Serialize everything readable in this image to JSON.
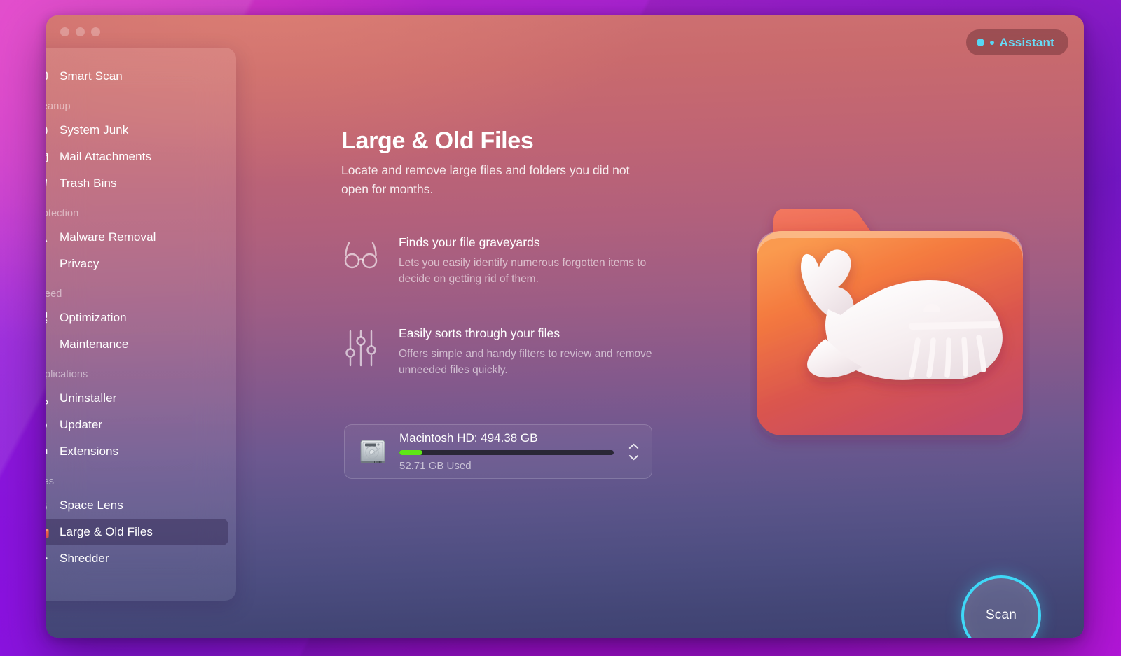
{
  "window": {
    "traffic_lights": [
      "close",
      "minimize",
      "maximize"
    ]
  },
  "assistant": {
    "label": "Assistant",
    "accent_color": "#67dcf8"
  },
  "sidebar": {
    "items": [
      {
        "label": "Smart Scan",
        "icon": "smart-scan-icon",
        "type": "item",
        "selected": false
      },
      {
        "label": "Cleanup",
        "type": "group"
      },
      {
        "label": "System Junk",
        "icon": "system-junk-icon",
        "type": "item",
        "selected": false
      },
      {
        "label": "Mail Attachments",
        "icon": "mail-attachments-icon",
        "type": "item",
        "selected": false
      },
      {
        "label": "Trash Bins",
        "icon": "trash-bins-icon",
        "type": "item",
        "selected": false
      },
      {
        "label": "Protection",
        "type": "group"
      },
      {
        "label": "Malware Removal",
        "icon": "malware-removal-icon",
        "type": "item",
        "selected": false
      },
      {
        "label": "Privacy",
        "icon": "privacy-hand-icon",
        "type": "item",
        "selected": false
      },
      {
        "label": "Speed",
        "type": "group"
      },
      {
        "label": "Optimization",
        "icon": "optimization-sliders-icon",
        "type": "item",
        "selected": false
      },
      {
        "label": "Maintenance",
        "icon": "maintenance-wrench-icon",
        "type": "item",
        "selected": false
      },
      {
        "label": "Applications",
        "type": "group"
      },
      {
        "label": "Uninstaller",
        "icon": "uninstaller-icon",
        "type": "item",
        "selected": false
      },
      {
        "label": "Updater",
        "icon": "updater-arrow-icon",
        "type": "item",
        "selected": false
      },
      {
        "label": "Extensions",
        "icon": "extensions-puzzle-icon",
        "type": "item",
        "selected": false
      },
      {
        "label": "Files",
        "type": "group"
      },
      {
        "label": "Space Lens",
        "icon": "space-lens-icon",
        "type": "item",
        "selected": false
      },
      {
        "label": "Large & Old Files",
        "icon": "large-old-files-folder-icon",
        "type": "item",
        "selected": true
      },
      {
        "label": "Shredder",
        "icon": "shredder-icon",
        "type": "item",
        "selected": false
      }
    ]
  },
  "main": {
    "title": "Large & Old Files",
    "subtitle": "Locate and remove large files and folders you did not open for months.",
    "features": [
      {
        "icon": "glasses-icon",
        "title": "Finds your file graveyards",
        "description": "Lets you easily identify numerous forgotten items to decide on getting rid of them."
      },
      {
        "icon": "sliders-icon",
        "title": "Easily sorts through your files",
        "description": "Offers simple and handy filters to review and remove unneeded files quickly."
      }
    ],
    "drive": {
      "icon": "hard-disk-icon",
      "name": "Macintosh HD: 494.38 GB",
      "used_label": "52.71 GB Used",
      "used_percent": 10.7,
      "bar_color": "#5ee617",
      "stepper_icon": "stepper-up-down-icon"
    },
    "illustration": "orange-folder-with-whale-icon",
    "scan_button": {
      "label": "Scan",
      "ring_color": "#3fd8f7"
    }
  }
}
